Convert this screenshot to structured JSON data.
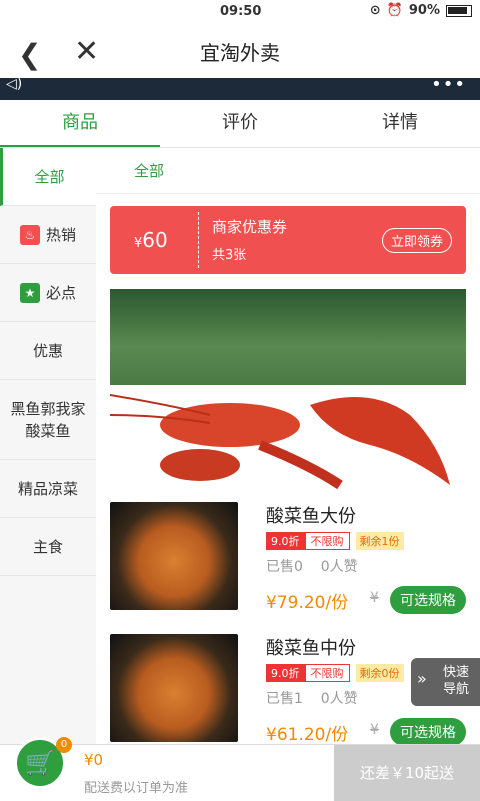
{
  "status": {
    "time": "09:50",
    "battery": "90%"
  },
  "header": {
    "title": "宜淘外卖"
  },
  "tabs": [
    "商品",
    "评价",
    "详情"
  ],
  "sidebar": {
    "items": [
      {
        "label": "全部"
      },
      {
        "label": "热销"
      },
      {
        "label": "必点"
      },
      {
        "label": "优惠"
      },
      {
        "label": "黑鱼郭我家酸菜鱼"
      },
      {
        "label": "精品凉菜"
      },
      {
        "label": "主食"
      }
    ]
  },
  "main": {
    "category_title": "全部",
    "coupon": {
      "currency": "¥",
      "amount": "60",
      "title": "商家优惠券",
      "count": "共3张",
      "button": "立即领券"
    },
    "items": [
      {
        "name": "酸菜鱼大份",
        "discount": "9.0折",
        "limit": "不限购",
        "remaining": "剩余1份",
        "sold": "已售0",
        "likes": "0人赞",
        "price": "¥79.20/份",
        "original": "¥",
        "spec": "可选规格"
      },
      {
        "name": "酸菜鱼中份",
        "discount": "9.0折",
        "limit": "不限购",
        "remaining": "剩余0份",
        "sold": "已售1",
        "likes": "0人赞",
        "price": "¥61.20/份",
        "original": "¥",
        "spec": "可选规格"
      }
    ]
  },
  "fast_nav": {
    "line1": "快速",
    "line2": "导航"
  },
  "cart": {
    "badge": "0",
    "total": "¥0",
    "delivery": "配送费以订单为准",
    "need_more": "还差￥10起送"
  },
  "colors": {
    "accent": "#2e9e3e",
    "coupon": "#f05050",
    "price": "#f08a00"
  }
}
